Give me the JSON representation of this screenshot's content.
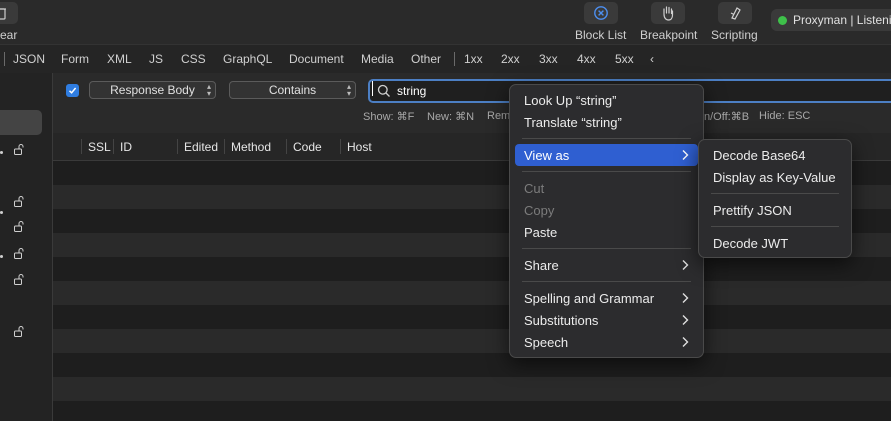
{
  "toolbar": {
    "clear_label": "ear",
    "block_list_label": "Block List",
    "breakpoint_label": "Breakpoint",
    "scripting_label": "Scripting",
    "status_text": "Proxyman | Listenin",
    "status_color": "#3ec14a"
  },
  "filter_tabs": [
    "JSON",
    "Form",
    "XML",
    "JS",
    "CSS",
    "GraphQL",
    "Document",
    "Media",
    "Other"
  ],
  "status_tabs": [
    "1xx",
    "2xx",
    "3xx",
    "4xx",
    "5xx"
  ],
  "status_tabs_more": "‹",
  "search": {
    "checkbox_checked": true,
    "scope_select": "Response Body",
    "mode_select": "Contains",
    "query": "string"
  },
  "hints": {
    "show": "Show: ⌘F",
    "new": "New: ⌘N",
    "remove_partial": "Rem",
    "onoff_partial": "n/Off:⌘B",
    "hide": "Hide: ESC"
  },
  "table": {
    "columns": [
      "SSL",
      "ID",
      "Edited",
      "Method",
      "Code",
      "Host"
    ]
  },
  "context_menu": {
    "look_up": "Look Up “string”",
    "translate": "Translate “string”",
    "view_as": "View as",
    "cut": "Cut",
    "copy": "Copy",
    "paste": "Paste",
    "share": "Share",
    "spelling": "Spelling and Grammar",
    "substitutions": "Substitutions",
    "speech": "Speech"
  },
  "submenu": {
    "decode_base64": "Decode Base64",
    "display_key_value": "Display as Key-Value",
    "prettify_json": "Prettify JSON",
    "decode_jwt": "Decode JWT"
  },
  "colors": {
    "accent": "#2f5fd1",
    "search_border": "#4c7fc4"
  }
}
